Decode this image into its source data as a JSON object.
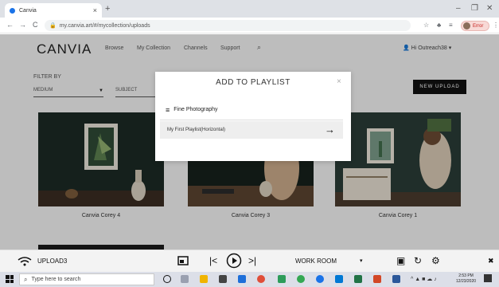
{
  "browser": {
    "tab_title": "Canvia",
    "tab_close": "×",
    "new_tab": "+",
    "minimize": "–",
    "maximize": "❐",
    "close": "✕",
    "back": "←",
    "forward": "→",
    "reload": "C",
    "url": "my.canvia.art/#/mycollection/uploads",
    "profile_label": "Error"
  },
  "site": {
    "logo": "CANVIA",
    "nav": [
      "Browse",
      "My Collection",
      "Channels",
      "Support"
    ],
    "user_menu": "Hi Outreach38 ▾"
  },
  "filters": {
    "label": "FILTER BY",
    "medium": "MEDIUM",
    "subject": "SUBJECT"
  },
  "new_upload_label": "NEW UPLOAD",
  "cards": [
    {
      "caption": "Canvia Corey 4"
    },
    {
      "caption": "Canvia Corey 3"
    },
    {
      "caption": "Canvia Corey 1"
    }
  ],
  "modal": {
    "title": "ADD TO PLAYLIST",
    "close": "×",
    "playlists": [
      "Fine Photography",
      "My First Playlist(Horizontal)"
    ],
    "go_icon": "→"
  },
  "media_bar": {
    "device": "UPLOAD3",
    "room": "WORK ROOM",
    "room_arrow": "▾"
  },
  "taskbar": {
    "search_placeholder": "Type here to search",
    "time": "2:53 PM",
    "date": "12/23/2020"
  },
  "icons": {
    "wifi": "wifi-icon",
    "cast": "cast-icon",
    "prev": "skip-previous-icon",
    "play": "play-icon",
    "next": "skip-next-icon",
    "calendar": "calendar-icon",
    "timer": "timer-icon",
    "settings": "settings-icon"
  }
}
